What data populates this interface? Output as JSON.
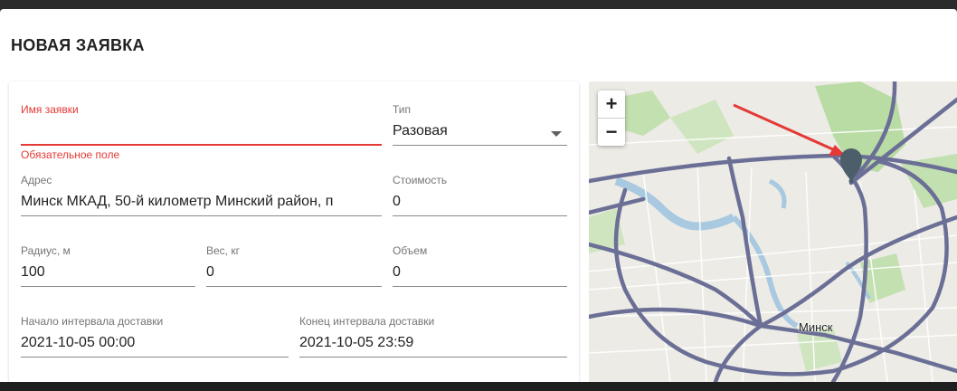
{
  "dialog": {
    "title": "НОВАЯ ЗАЯВКА"
  },
  "form": {
    "name": {
      "label": "Имя заявки",
      "value": "",
      "error": "Обязательное поле"
    },
    "type": {
      "label": "Тип",
      "value": "Разовая"
    },
    "address": {
      "label": "Адрес",
      "value": "Минск МКАД, 50-й километр Минский район, п"
    },
    "cost": {
      "label": "Стоимость",
      "value": "0"
    },
    "radius": {
      "label": "Радиус, м",
      "value": "100"
    },
    "weight": {
      "label": "Вес, кг",
      "value": "0"
    },
    "volume": {
      "label": "Объем",
      "value": "0"
    },
    "start": {
      "label": "Начало интервала доставки",
      "value": "2021-10-05 00:00"
    },
    "end": {
      "label": "Конец интервала доставки",
      "value": "2021-10-05 23:59"
    }
  },
  "map": {
    "zoom_in": "+",
    "zoom_out": "−",
    "city_label": "Минск",
    "colors": {
      "road": "#6b6f96",
      "water": "#a8c9e0",
      "park": "#b9dba4",
      "marker": "#4d5e6b",
      "arrow": "#e53935"
    }
  }
}
